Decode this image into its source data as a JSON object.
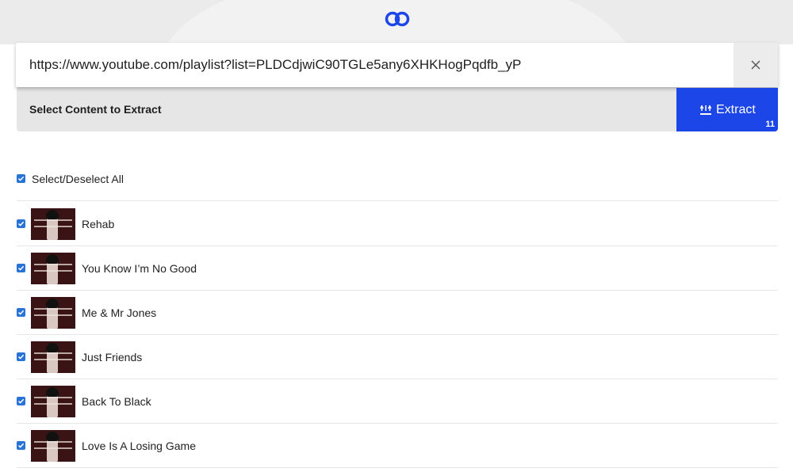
{
  "header": {
    "logo_icon": "chain-link-icon",
    "accent_color": "#1c46e8"
  },
  "url_input": {
    "value": "https://www.youtube.com/playlist?list=PLDCdjwiC90TGLe5any6XHKHogPqdfb_yP",
    "clear_icon": "close-icon"
  },
  "options": {
    "label": "Select Content to Extract"
  },
  "extract": {
    "label": "Extract",
    "count": "11",
    "icon": "extract-icon"
  },
  "select_all": {
    "label": "Select/Deselect All",
    "checked": true
  },
  "items": [
    {
      "title": "Rehab",
      "checked": true
    },
    {
      "title": "You Know I’m No Good",
      "checked": true
    },
    {
      "title": "Me & Mr Jones",
      "checked": true
    },
    {
      "title": "Just Friends",
      "checked": true
    },
    {
      "title": "Back To Black",
      "checked": true
    },
    {
      "title": "Love Is A Losing Game",
      "checked": true
    }
  ]
}
